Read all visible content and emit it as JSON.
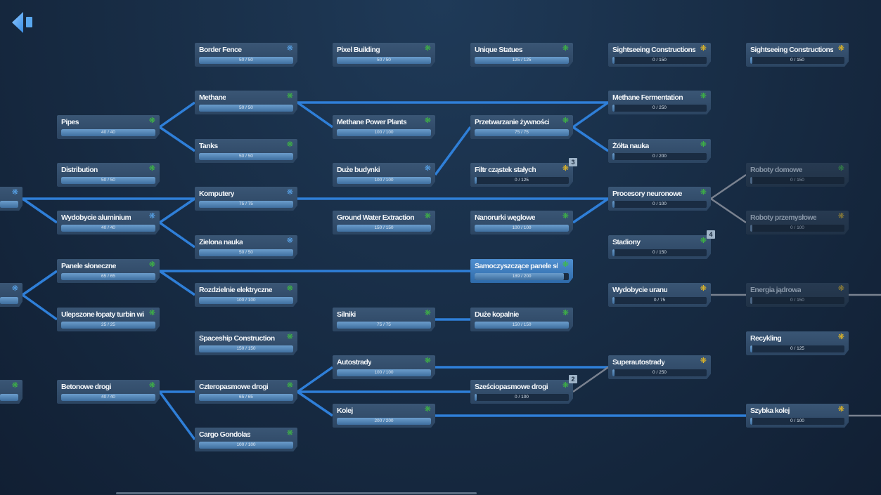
{
  "back_button": {
    "icon": "back-arrow-icon"
  },
  "colors": {
    "link_active": "#2f7fd8",
    "link_locked": "#7a8290",
    "icon_green": "#3fbf3f",
    "icon_blue": "#5aa8f0",
    "icon_yellow": "#f0c020"
  },
  "nodes": [
    {
      "id": "border_fence",
      "name": "Border Fence",
      "progress": "50 / 50",
      "value": 50,
      "max": 50,
      "icon": "blue"
    },
    {
      "id": "methane",
      "name": "Methane",
      "progress": "50 / 50",
      "value": 50,
      "max": 50,
      "icon": "green"
    },
    {
      "id": "tanks",
      "name": "Tanks",
      "progress": "50 / 50",
      "value": 50,
      "max": 50,
      "icon": "green"
    },
    {
      "id": "komputery",
      "name": "Komputery",
      "progress": "75 / 75",
      "value": 75,
      "max": 75,
      "icon": "blue"
    },
    {
      "id": "zielona",
      "name": "Zielona nauka",
      "progress": "50 / 50",
      "value": 50,
      "max": 50,
      "icon": "blue"
    },
    {
      "id": "rozdzielnie",
      "name": "Rozdzielnie elektryczne",
      "progress": "100 / 100",
      "value": 100,
      "max": 100,
      "icon": "green"
    },
    {
      "id": "spaceship",
      "name": "Spaceship Construction",
      "progress": "150 / 150",
      "value": 150,
      "max": 150,
      "icon": "green"
    },
    {
      "id": "czteropasmowe",
      "name": "Czteropasmowe drogi",
      "progress": "65 / 65",
      "value": 65,
      "max": 65,
      "icon": "green"
    },
    {
      "id": "cargo",
      "name": "Cargo Gondolas",
      "progress": "100 / 100",
      "value": 100,
      "max": 100,
      "icon": "green"
    },
    {
      "id": "pipes",
      "name": "Pipes",
      "progress": "40 / 40",
      "value": 40,
      "max": 40,
      "icon": "green"
    },
    {
      "id": "distribution",
      "name": "Distribution",
      "progress": "50 / 50",
      "value": 50,
      "max": 50,
      "icon": "green"
    },
    {
      "id": "aluminium",
      "name": "Wydobycie aluminium",
      "progress": "40 / 40",
      "value": 40,
      "max": 40,
      "icon": "blue"
    },
    {
      "id": "panele",
      "name": "Panele słoneczne",
      "progress": "65 / 65",
      "value": 65,
      "max": 65,
      "icon": "green"
    },
    {
      "id": "lopaty",
      "name": "Ulepszone łopaty turbin wiatrowych",
      "progress": "25 / 25",
      "value": 25,
      "max": 25,
      "icon": "green"
    },
    {
      "id": "betonowe",
      "name": "Betonowe drogi",
      "progress": "40 / 40",
      "value": 40,
      "max": 40,
      "icon": "green"
    },
    {
      "id": "pixel",
      "name": "Pixel Building",
      "progress": "50 / 50",
      "value": 50,
      "max": 50,
      "icon": "green"
    },
    {
      "id": "methane_pp",
      "name": "Methane Power Plants",
      "progress": "100 / 100",
      "value": 100,
      "max": 100,
      "icon": "green"
    },
    {
      "id": "duze_budynki",
      "name": "Duże budynki",
      "progress": "100 / 100",
      "value": 100,
      "max": 100,
      "icon": "blue"
    },
    {
      "id": "groundwater",
      "name": "Ground Water Extraction",
      "progress": "150 / 150",
      "value": 150,
      "max": 150,
      "icon": "green"
    },
    {
      "id": "silniki",
      "name": "Silniki",
      "progress": "75 / 75",
      "value": 75,
      "max": 75,
      "icon": "green"
    },
    {
      "id": "autostrady",
      "name": "Autostrady",
      "progress": "100 / 100",
      "value": 100,
      "max": 100,
      "icon": "green"
    },
    {
      "id": "kolej",
      "name": "Kolej",
      "progress": "200 / 200",
      "value": 200,
      "max": 200,
      "icon": "green"
    },
    {
      "id": "statues",
      "name": "Unique Statues",
      "progress": "125 / 125",
      "value": 125,
      "max": 125,
      "icon": "green"
    },
    {
      "id": "przetwarzanie",
      "name": "Przetwarzanie żywności",
      "progress": "75 / 75",
      "value": 75,
      "max": 75,
      "icon": "green"
    },
    {
      "id": "filtr",
      "name": "Filtr cząstek stałych",
      "progress": "0 / 125",
      "value": 0,
      "max": 125,
      "icon": "yellow",
      "badge": "3"
    },
    {
      "id": "nanorurki",
      "name": "Nanorurki węglowe",
      "progress": "100 / 100",
      "value": 100,
      "max": 100,
      "icon": "green"
    },
    {
      "id": "samoczyszczace",
      "name": "Samoczyszczące panele słoneczne",
      "progress": "189 / 200",
      "value": 189,
      "max": 200,
      "icon": "green",
      "state": "selected"
    },
    {
      "id": "kopalnie",
      "name": "Duże kopalnie",
      "progress": "150 / 150",
      "value": 150,
      "max": 150,
      "icon": "green"
    },
    {
      "id": "szesciopasmowe",
      "name": "Sześciopasmowe drogi",
      "progress": "0 / 100",
      "value": 0,
      "max": 100,
      "icon": "green",
      "badge": "2"
    },
    {
      "id": "sightseeing_a",
      "name": "Sightseeing Constructions A",
      "progress": "0 / 150",
      "value": 0,
      "max": 150,
      "icon": "yellow"
    },
    {
      "id": "fermentation",
      "name": "Methane Fermentation",
      "progress": "0 / 250",
      "value": 0,
      "max": 250,
      "icon": "green"
    },
    {
      "id": "zolta",
      "name": "Żółta nauka",
      "progress": "0 / 200",
      "value": 0,
      "max": 200,
      "icon": "green"
    },
    {
      "id": "procesory",
      "name": "Procesory neuronowe",
      "progress": "0 / 100",
      "value": 0,
      "max": 100,
      "icon": "green"
    },
    {
      "id": "stadiony",
      "name": "Stadiony",
      "progress": "0 / 150",
      "value": 0,
      "max": 150,
      "icon": "green",
      "badge": "4"
    },
    {
      "id": "uran",
      "name": "Wydobycie uranu",
      "progress": "0 / 75",
      "value": 0,
      "max": 75,
      "icon": "yellow"
    },
    {
      "id": "superautostrady",
      "name": "Superautostrady",
      "progress": "0 / 250",
      "value": 0,
      "max": 250,
      "icon": "yellow"
    },
    {
      "id": "sightseeing_b",
      "name": "Sightseeing Constructions B",
      "progress": "0 / 150",
      "value": 0,
      "max": 150,
      "icon": "yellow"
    },
    {
      "id": "roboty_domowe",
      "name": "Roboty domowe",
      "progress": "0 / 150",
      "value": 0,
      "max": 150,
      "icon": "green",
      "state": "locked"
    },
    {
      "id": "roboty_przem",
      "name": "Roboty przemysłowe",
      "progress": "0 / 100",
      "value": 0,
      "max": 100,
      "icon": "yellow",
      "state": "locked"
    },
    {
      "id": "energia",
      "name": "Energia jądrowa",
      "progress": "0 / 150",
      "value": 0,
      "max": 150,
      "icon": "yellow",
      "state": "locked"
    },
    {
      "id": "recykling",
      "name": "Recykling",
      "progress": "0 / 125",
      "value": 0,
      "max": 125,
      "icon": "yellow"
    },
    {
      "id": "szybka_kolej",
      "name": "Szybka kolej",
      "progress": "0 / 100",
      "value": 0,
      "max": 100,
      "icon": "yellow"
    },
    {
      "id": "off_a",
      "name": "",
      "icon": "blue",
      "value": 1,
      "max": 1
    },
    {
      "id": "off_b",
      "name": "",
      "icon": "blue",
      "value": 1,
      "max": 1
    },
    {
      "id": "off_c",
      "name": "",
      "icon": "green",
      "value": 1,
      "max": 1
    }
  ],
  "links": [
    [
      "off_a",
      "komputery",
      "active"
    ],
    [
      "off_a",
      "aluminium",
      "active"
    ],
    [
      "pipes",
      "methane",
      "active"
    ],
    [
      "pipes",
      "tanks",
      "active"
    ],
    [
      "methane",
      "methane_pp",
      "active"
    ],
    [
      "methane",
      "fermentation",
      "active"
    ],
    [
      "aluminium",
      "komputery",
      "active"
    ],
    [
      "aluminium",
      "zielona",
      "active"
    ],
    [
      "komputery",
      "procesory",
      "active"
    ],
    [
      "duze_budynki",
      "przetwarzanie",
      "active"
    ],
    [
      "przetwarzanie",
      "fermentation",
      "active"
    ],
    [
      "przetwarzanie",
      "zolta",
      "active"
    ],
    [
      "nanorurki",
      "procesory",
      "active"
    ],
    [
      "procesory",
      "roboty_domowe",
      "locked"
    ],
    [
      "procesory",
      "roboty_przem",
      "locked"
    ],
    [
      "off_b",
      "panele",
      "active"
    ],
    [
      "off_b",
      "lopaty",
      "active"
    ],
    [
      "panele",
      "samoczyszczace",
      "active"
    ],
    [
      "panele",
      "rozdzielnie",
      "active"
    ],
    [
      "silniki",
      "kopalnie",
      "active"
    ],
    [
      "uran",
      "energia",
      "locked"
    ],
    [
      "energia",
      "EDGE",
      "locked"
    ],
    [
      "betonowe",
      "czteropasmowe",
      "active"
    ],
    [
      "betonowe",
      "cargo",
      "active"
    ],
    [
      "czteropasmowe",
      "autostrady",
      "active"
    ],
    [
      "czteropasmowe",
      "szesciopasmowe",
      "active"
    ],
    [
      "czteropasmowe",
      "kolej",
      "active"
    ],
    [
      "autostrady",
      "superautostrady",
      "active"
    ],
    [
      "szesciopasmowe",
      "superautostrady",
      "locked"
    ],
    [
      "kolej",
      "szybka_kolej",
      "active"
    ],
    [
      "szybka_kolej",
      "EDGE",
      "locked"
    ]
  ]
}
